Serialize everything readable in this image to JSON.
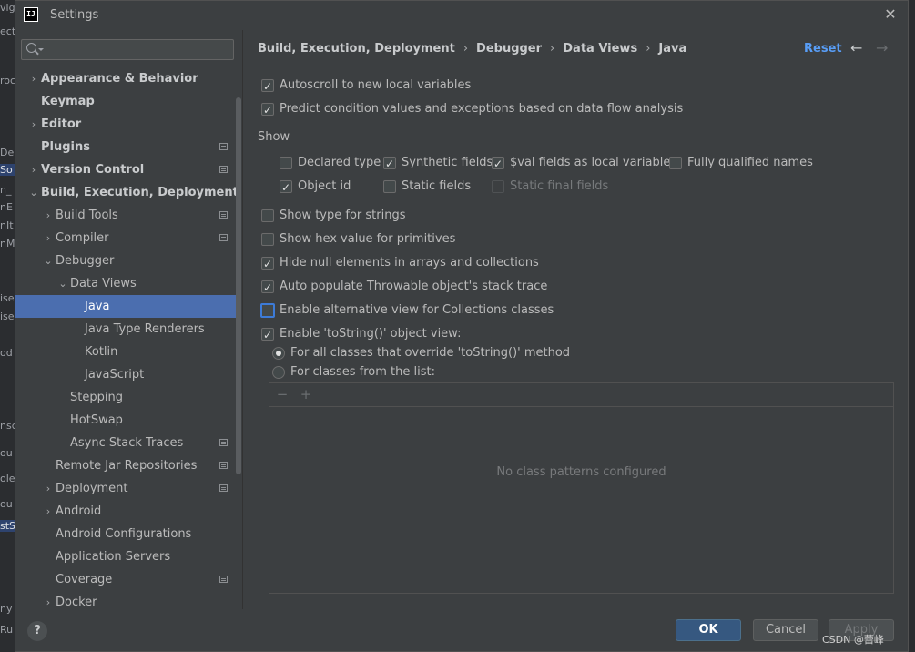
{
  "background_ide": {
    "fragments": [
      "vig",
      "ect",
      "roc",
      "De",
      "So",
      "n_",
      "nE",
      "nIt",
      "nM",
      "ise",
      "ise",
      "od",
      "nsc",
      "ou",
      "ole",
      "ou",
      "stS",
      "ny",
      "Ru"
    ]
  },
  "dialog": {
    "title": "Settings",
    "logo_text": "IJ"
  },
  "search": {
    "placeholder": "",
    "value": ""
  },
  "sidebar": {
    "items": [
      {
        "label": "Appearance & Behavior",
        "bold": true,
        "arrow": "›",
        "level": 0
      },
      {
        "label": "Keymap",
        "bold": true,
        "arrow": "",
        "level": 0
      },
      {
        "label": "Editor",
        "bold": true,
        "arrow": "›",
        "level": 0
      },
      {
        "label": "Plugins",
        "bold": true,
        "arrow": "",
        "level": 0,
        "project": true
      },
      {
        "label": "Version Control",
        "bold": true,
        "arrow": "›",
        "level": 0,
        "project": true
      },
      {
        "label": "Build, Execution, Deployment",
        "bold": true,
        "arrow": "⌄",
        "level": 0
      },
      {
        "label": "Build Tools",
        "arrow": "›",
        "level": 1,
        "project": true
      },
      {
        "label": "Compiler",
        "arrow": "›",
        "level": 1,
        "project": true
      },
      {
        "label": "Debugger",
        "arrow": "⌄",
        "level": 1
      },
      {
        "label": "Data Views",
        "arrow": "⌄",
        "level": 2
      },
      {
        "label": "Java",
        "level": 3,
        "selected": true
      },
      {
        "label": "Java Type Renderers",
        "level": 3
      },
      {
        "label": "Kotlin",
        "level": 3
      },
      {
        "label": "JavaScript",
        "level": 3
      },
      {
        "label": "Stepping",
        "level": 2
      },
      {
        "label": "HotSwap",
        "level": 2
      },
      {
        "label": "Async Stack Traces",
        "level": 2,
        "project": true
      },
      {
        "label": "Remote Jar Repositories",
        "level": 1,
        "project": true
      },
      {
        "label": "Deployment",
        "arrow": "›",
        "level": 1,
        "project": true
      },
      {
        "label": "Android",
        "arrow": "›",
        "level": 1
      },
      {
        "label": "Android Configurations",
        "level": 1
      },
      {
        "label": "Application Servers",
        "level": 1
      },
      {
        "label": "Coverage",
        "level": 1,
        "project": true
      },
      {
        "label": "Docker",
        "arrow": "›",
        "level": 1
      }
    ]
  },
  "breadcrumb": [
    "Build, Execution, Deployment",
    "Debugger",
    "Data Views",
    "Java"
  ],
  "breadcrumb_sep": "›",
  "header": {
    "reset": "Reset",
    "back": "←",
    "forward": "→"
  },
  "options": {
    "autoscroll": {
      "label": "Autoscroll to new local variables",
      "checked": true
    },
    "predict": {
      "label": "Predict condition values and exceptions based on data flow analysis",
      "checked": true
    },
    "show_label": "Show",
    "show": [
      {
        "key": "declared_type",
        "label": "Declared type",
        "checked": false
      },
      {
        "key": "synthetic_fields",
        "label": "Synthetic fields",
        "checked": true
      },
      {
        "key": "val_fields",
        "label": "$val fields as local variables",
        "checked": true
      },
      {
        "key": "fully_qualified",
        "label": "Fully qualified names",
        "checked": false
      },
      {
        "key": "object_id",
        "label": "Object id",
        "checked": true
      },
      {
        "key": "static_fields",
        "label": "Static fields",
        "checked": false
      },
      {
        "key": "static_final_fields",
        "label": "Static final fields",
        "checked": false,
        "disabled": true
      }
    ],
    "type_strings": {
      "label": "Show type for strings",
      "checked": false
    },
    "hex_primitives": {
      "label": "Show hex value for primitives",
      "checked": false
    },
    "hide_null": {
      "label": "Hide null elements in arrays and collections",
      "checked": true
    },
    "throwable": {
      "label": "Auto populate Throwable object's stack trace",
      "checked": true
    },
    "alt_view": {
      "label": "Enable alternative view for Collections classes",
      "checked": false
    },
    "tostring": {
      "label": "Enable 'toString()' object view:",
      "checked": true
    },
    "tostring_all": {
      "label": "For all classes that override 'toString()' method",
      "selected": true
    },
    "tostring_list": {
      "label": "For classes from the list:",
      "selected": false
    }
  },
  "list": {
    "remove": "−",
    "add": "+",
    "empty": "No class patterns configured"
  },
  "footer": {
    "help": "?",
    "ok": "OK",
    "cancel": "Cancel",
    "apply": "Apply",
    "watermark": "CSDN @蕾峰"
  },
  "colors": {
    "accent": "#4b6eaf",
    "link": "#589df6",
    "ok_button": "#365880",
    "background": "#3c3f41"
  }
}
